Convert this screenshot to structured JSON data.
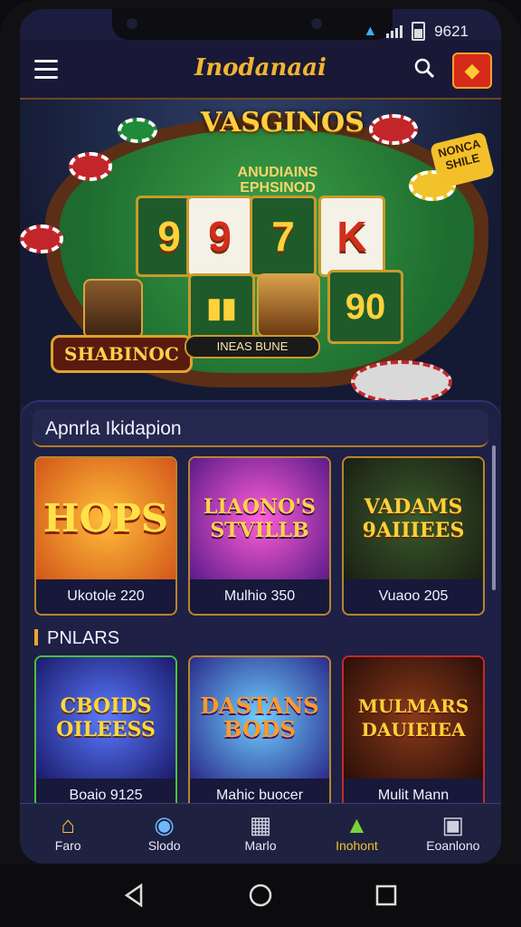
{
  "status_bar": {
    "time": "9621"
  },
  "app": {
    "title": "Inodanaai"
  },
  "hero": {
    "title": "VASGINOS",
    "subtitle": "ANUDIAINS EPHSINOD",
    "reels_top": [
      "9",
      "9",
      "7",
      "K"
    ],
    "reel_small": "90",
    "badge": "SHABINOC",
    "jackpot": "INEAS BUNE",
    "sign": "NONCA SHILE"
  },
  "section1": {
    "title": "Apnrla Ikidapion",
    "cards": [
      {
        "art": "HOPS",
        "caption": "Ukotole 220"
      },
      {
        "art": "LIAONO'S STVILLB",
        "caption": "Mulhio 350"
      },
      {
        "art": "VADAMS 9AIIIEES",
        "caption": "Vuaoo 205"
      }
    ]
  },
  "section2": {
    "title": "PNLARS",
    "cards": [
      {
        "art": "CBOIDS OILEESS",
        "caption": "Boaio 9125"
      },
      {
        "art": "DASTANS BODS",
        "caption": "Mahic buocer"
      },
      {
        "art": "MULMARS DAUIEIEA",
        "caption": "Mulit Mann"
      }
    ]
  },
  "tabs": [
    {
      "label": "Faro",
      "icon": "home-icon"
    },
    {
      "label": "Slodo",
      "icon": "slots-icon"
    },
    {
      "label": "Marlo",
      "icon": "wallet-icon"
    },
    {
      "label": "Inohont",
      "icon": "home-active-icon"
    },
    {
      "label": "Eoanlono",
      "icon": "briefcase-icon"
    }
  ],
  "colors": {
    "accent": "#f0b431",
    "background": "#1b1d3e",
    "active_tab": "#f5c431"
  }
}
